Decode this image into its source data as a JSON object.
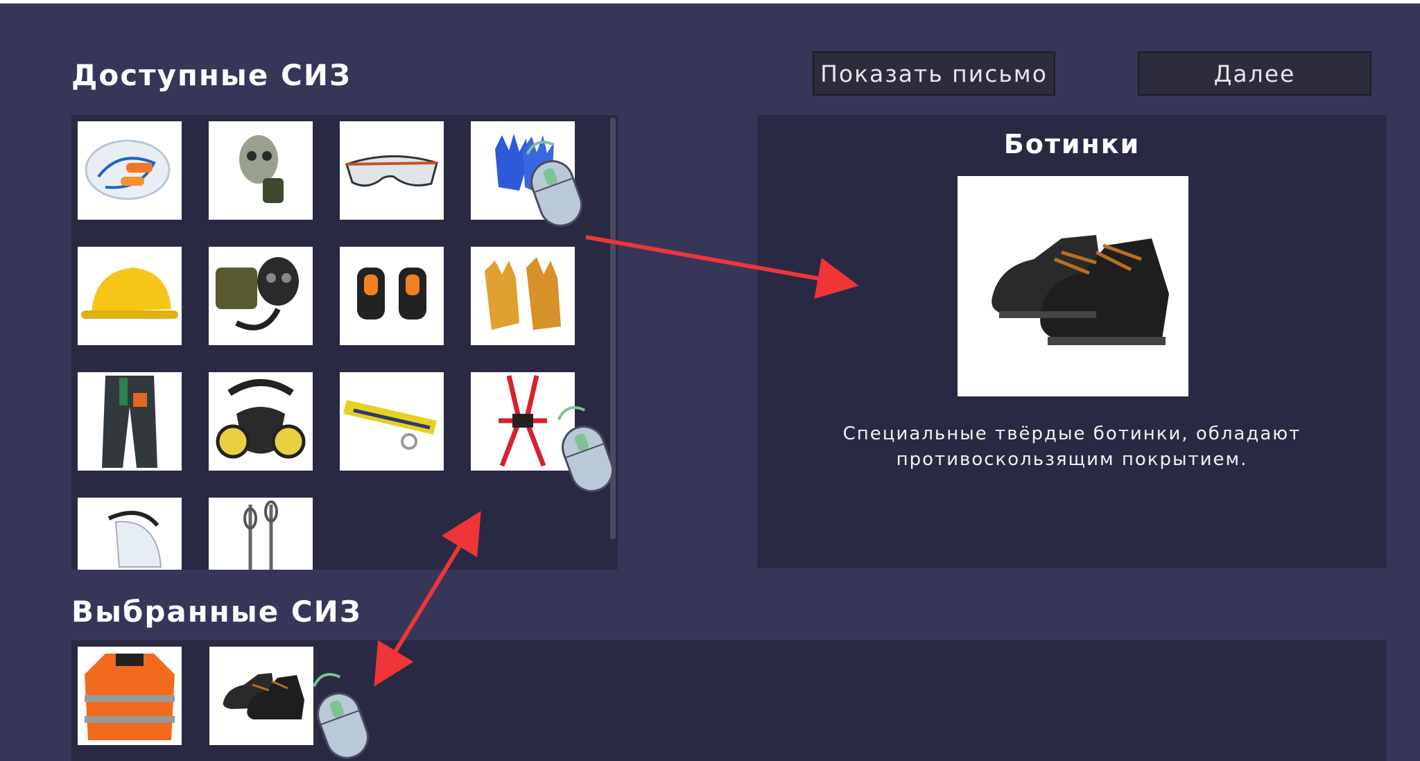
{
  "available": {
    "heading": "Доступные СИЗ",
    "items": [
      {
        "icon": "earplugs-icon"
      },
      {
        "icon": "gas-mask-icon"
      },
      {
        "icon": "safety-glasses-icon"
      },
      {
        "icon": "work-gloves-icon"
      },
      {
        "icon": "hard-hat-icon"
      },
      {
        "icon": "gas-mask-kit-icon"
      },
      {
        "icon": "knee-pads-icon"
      },
      {
        "icon": "welding-gloves-icon"
      },
      {
        "icon": "work-trousers-icon"
      },
      {
        "icon": "respirator-icon"
      },
      {
        "icon": "safety-belt-icon"
      },
      {
        "icon": "safety-harness-icon"
      },
      {
        "icon": "face-shield-icon"
      },
      {
        "icon": "lanyard-icon"
      }
    ]
  },
  "buttons": {
    "show_letter": "Показать письмо",
    "next": "Далее"
  },
  "detail": {
    "title": "Ботинки",
    "image_icon": "boots-icon",
    "description_line1": "Специальные твёрдые ботинки, обладают",
    "description_line2": "противоскользящим покрытием."
  },
  "selected": {
    "heading": "Выбранные СИЗ",
    "items": [
      {
        "icon": "hi-vis-jacket-icon"
      },
      {
        "icon": "boots-icon"
      }
    ]
  },
  "colors": {
    "background": "#363659",
    "panel": "#292943",
    "arrow": "#ef3538",
    "mouse_body": "#b9c9d8",
    "mouse_button": "#7ec296"
  }
}
